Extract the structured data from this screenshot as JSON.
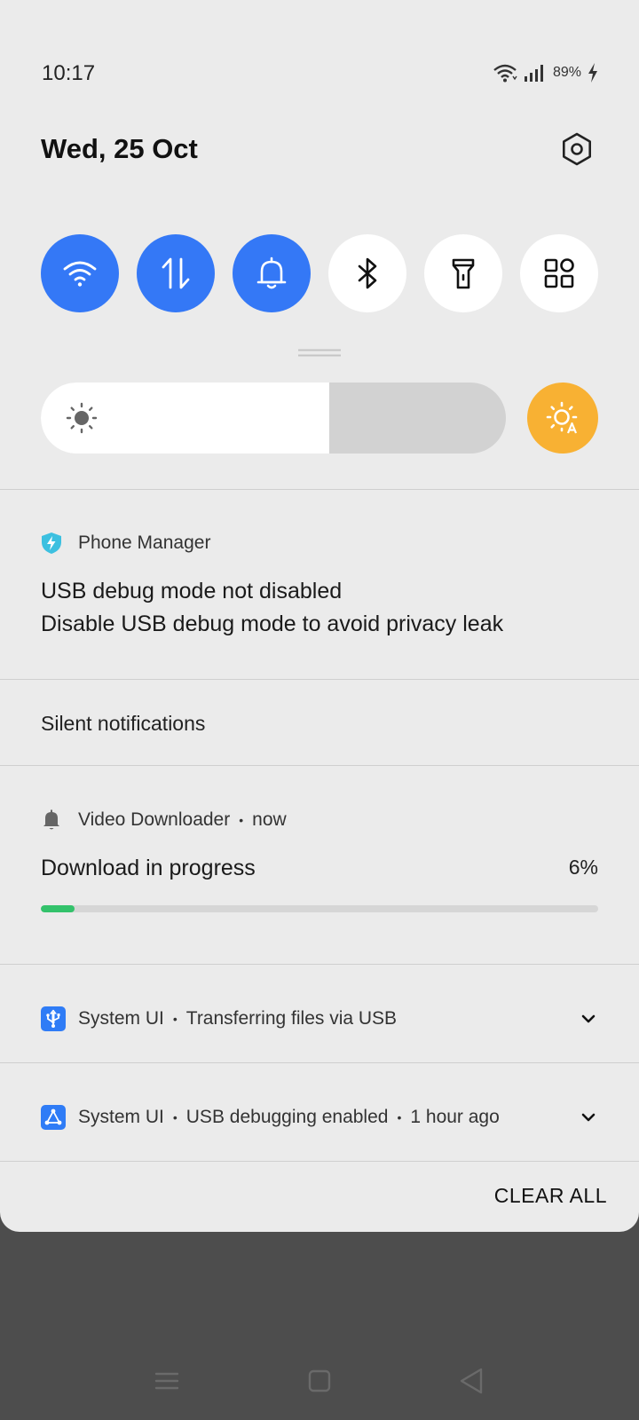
{
  "status_bar": {
    "time": "10:17",
    "battery": "89%",
    "icons": [
      "wifi-icon",
      "signal-icon",
      "charging-icon"
    ]
  },
  "header": {
    "date": "Wed, 25 Oct",
    "settings_icon": "settings-icon"
  },
  "quick_tiles": [
    {
      "name": "wifi",
      "icon": "wifi-icon",
      "active": true
    },
    {
      "name": "mobile-data",
      "icon": "data-arrows-icon",
      "active": true
    },
    {
      "name": "sound",
      "icon": "bell-icon",
      "active": true
    },
    {
      "name": "bluetooth",
      "icon": "bluetooth-icon",
      "active": false
    },
    {
      "name": "flashlight",
      "icon": "flashlight-icon",
      "active": false
    },
    {
      "name": "more",
      "icon": "grid-icon",
      "active": false
    }
  ],
  "brightness": {
    "level": 0.62,
    "auto_icon": "auto-brightness-icon"
  },
  "colors": {
    "accent": "#3478f6",
    "tile_off": "#ffffff",
    "auto_brightness": "#f8b133",
    "progress": "#33c26b"
  },
  "notifications": {
    "phone_manager": {
      "app": "Phone Manager",
      "title": "USB debug mode not disabled",
      "text": "Disable USB debug mode to avoid privacy leak"
    },
    "silent_header": "Silent notifications",
    "video_downloader": {
      "app": "Video Downloader",
      "time": "now",
      "title": "Download in progress",
      "percent_text": "6%",
      "progress": 0.06
    },
    "system_usb_transfer": {
      "app": "System UI",
      "text": "Transferring files via USB"
    },
    "system_usb_debug": {
      "app": "System UI",
      "text": "USB debugging enabled",
      "time": "1 hour ago"
    },
    "clear_all": "CLEAR ALL"
  },
  "nav_bar": [
    "menu-icon",
    "home-icon",
    "back-icon"
  ]
}
